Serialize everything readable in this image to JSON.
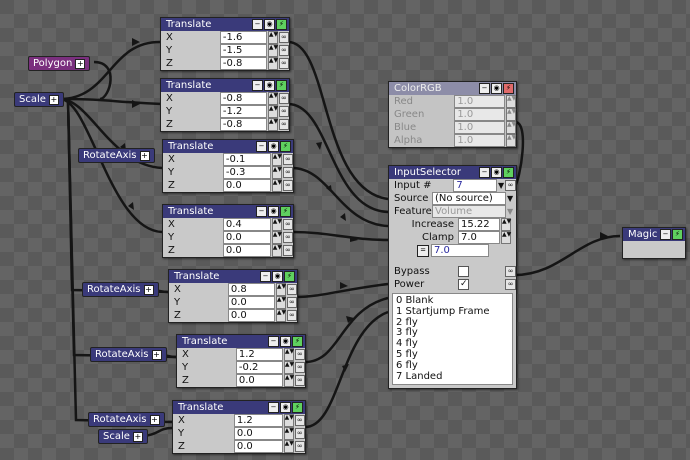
{
  "pills": {
    "polygon": "Polygon",
    "scale_top": "Scale",
    "scale_bottom": "Scale",
    "rotate1": "RotateAxis",
    "rotate2": "RotateAxis",
    "rotate3": "RotateAxis",
    "rotate4": "RotateAxis",
    "plus": "+"
  },
  "translate_nodes": [
    {
      "title": "Translate",
      "x": "-1.6",
      "y": "-1.5",
      "z": "-0.8"
    },
    {
      "title": "Translate",
      "x": "-0.8",
      "y": "-1.2",
      "z": "-0.8"
    },
    {
      "title": "Translate",
      "x": "-0.1",
      "y": "-0.3",
      "z": "0.0"
    },
    {
      "title": "Translate",
      "x": "0.4",
      "y": "0.0",
      "z": "0.0"
    },
    {
      "title": "Translate",
      "x": "0.8",
      "y": "0.0",
      "z": "0.0"
    },
    {
      "title": "Translate",
      "x": "1.2",
      "y": "-0.2",
      "z": "0.0"
    },
    {
      "title": "Translate",
      "x": "1.2",
      "y": "0.0",
      "z": "0.0"
    }
  ],
  "axis_labels": {
    "x": "X",
    "y": "Y",
    "z": "Z"
  },
  "color_node": {
    "title": "ColorRGB",
    "red_label": "Red",
    "red": "1.0",
    "green_label": "Green",
    "green": "1.0",
    "blue_label": "Blue",
    "blue": "1.0",
    "alpha_label": "Alpha",
    "alpha": "1.0"
  },
  "input_selector": {
    "title": "InputSelector",
    "input_label": "Input #",
    "input_value": "7",
    "source_label": "Source",
    "source_value": "(No source)",
    "feature_label": "Feature",
    "feature_value": "Volume",
    "increase_label": "Increase",
    "increase_value": "15.22",
    "clamp_label": "Clamp",
    "clamp_value": "7.0",
    "eq_value": "7.0",
    "bypass_label": "Bypass",
    "power_label": "Power",
    "inputs": [
      "0 Blank",
      "1 Startjump Frame",
      "2 fly",
      "3 fly",
      "4 fly",
      "5 fly",
      "6 fly",
      "7 Landed"
    ]
  },
  "magic": {
    "title": "Magic"
  },
  "colors": {
    "header": "#3a3a7a",
    "header_faded": "#8d8da8",
    "wire": "#151515",
    "toggle_green": "#5fd05f"
  },
  "icons": [
    "minimize-icon",
    "eye-icon",
    "power-icon",
    "link-icon",
    "plus-icon",
    "dropdown-icon",
    "checkbox-icon"
  ]
}
